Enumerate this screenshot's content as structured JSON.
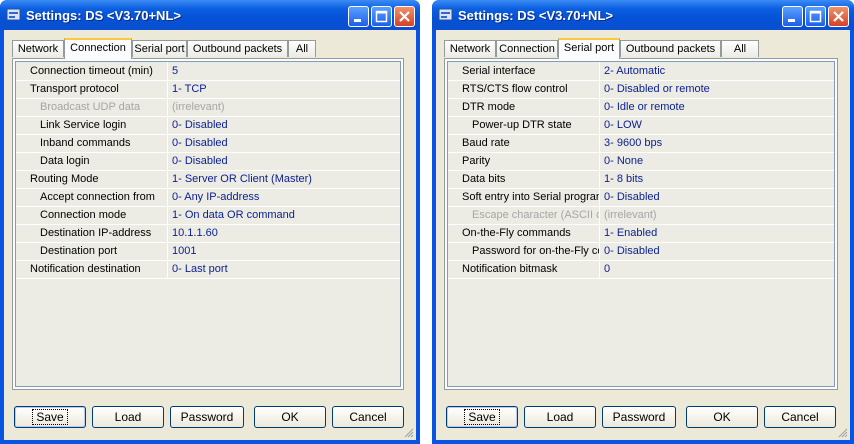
{
  "windows": [
    {
      "title": "Settings: DS <V3.70+NL>",
      "tabs": [
        {
          "label": "Network",
          "active": false
        },
        {
          "label": "Connection",
          "active": true
        },
        {
          "label": "Serial port",
          "active": false
        },
        {
          "label": "Outbound packets",
          "active": false
        },
        {
          "label": "All",
          "active": false
        }
      ],
      "rows": [
        {
          "label": "Connection timeout (min)",
          "value": "5",
          "indent": 0,
          "disabled": false
        },
        {
          "label": "Transport protocol",
          "value": "1- TCP",
          "indent": 0,
          "disabled": false
        },
        {
          "label": "Broadcast UDP data",
          "value": "(irrelevant)",
          "indent": 1,
          "disabled": true
        },
        {
          "label": "Link Service login",
          "value": "0- Disabled",
          "indent": 1,
          "disabled": false
        },
        {
          "label": "Inband commands",
          "value": "0- Disabled",
          "indent": 1,
          "disabled": false
        },
        {
          "label": "Data login",
          "value": "0- Disabled",
          "indent": 1,
          "disabled": false
        },
        {
          "label": "Routing Mode",
          "value": "1- Server OR Client (Master)",
          "indent": 0,
          "disabled": false
        },
        {
          "label": "Accept connection from",
          "value": "0- Any IP-address",
          "indent": 1,
          "disabled": false
        },
        {
          "label": "Connection mode",
          "value": "1- On data OR command",
          "indent": 1,
          "disabled": false
        },
        {
          "label": "Destination IP-address",
          "value": "10.1.1.60",
          "indent": 1,
          "disabled": false
        },
        {
          "label": "Destination port",
          "value": "1001",
          "indent": 1,
          "disabled": false
        },
        {
          "label": "Notification destination",
          "value": "0- Last port",
          "indent": 0,
          "disabled": false
        }
      ],
      "buttons": {
        "save": "Save",
        "load": "Load",
        "password": "Password",
        "ok": "OK",
        "cancel": "Cancel"
      }
    },
    {
      "title": "Settings: DS <V3.70+NL>",
      "tabs": [
        {
          "label": "Network",
          "active": false
        },
        {
          "label": "Connection",
          "active": false
        },
        {
          "label": "Serial port",
          "active": true
        },
        {
          "label": "Outbound packets",
          "active": false
        },
        {
          "label": "All",
          "active": false
        }
      ],
      "rows": [
        {
          "label": "Serial interface",
          "value": "2- Automatic",
          "indent": 0,
          "disabled": false
        },
        {
          "label": "RTS/CTS flow control",
          "value": "0- Disabled or remote",
          "indent": 0,
          "disabled": false
        },
        {
          "label": "DTR mode",
          "value": "0- Idle or remote",
          "indent": 0,
          "disabled": false
        },
        {
          "label": "Power-up DTR state",
          "value": "0- LOW",
          "indent": 1,
          "disabled": false
        },
        {
          "label": "Baud rate",
          "value": "3- 9600 bps",
          "indent": 0,
          "disabled": false
        },
        {
          "label": "Parity",
          "value": "0- None",
          "indent": 0,
          "disabled": false
        },
        {
          "label": "Data bits",
          "value": "1- 8 bits",
          "indent": 0,
          "disabled": false
        },
        {
          "label": "Soft entry into Serial programming",
          "value": "0- Disabled",
          "indent": 0,
          "disabled": false
        },
        {
          "label": "Escape character (ASCII code)",
          "value": "(irrelevant)",
          "indent": 1,
          "disabled": true
        },
        {
          "label": "On-the-Fly commands",
          "value": "1- Enabled",
          "indent": 0,
          "disabled": false
        },
        {
          "label": "Password for on-the-Fly commands",
          "value": "0- Disabled",
          "indent": 1,
          "disabled": false
        },
        {
          "label": "Notification bitmask",
          "value": "0",
          "indent": 0,
          "disabled": false
        }
      ],
      "buttons": {
        "save": "Save",
        "load": "Load",
        "password": "Password",
        "ok": "OK",
        "cancel": "Cancel"
      }
    }
  ],
  "icons": {
    "app": "settings-app-icon",
    "minimize": "minimize-icon",
    "maximize": "maximize-icon",
    "close": "close-icon",
    "grip": "resize-grip-icon"
  },
  "colors": {
    "titlebar": "#0a54e3",
    "value_text": "#0a1f8f",
    "active_tab_accent": "#ffc83c",
    "disabled_text": "#a6a6a6"
  }
}
